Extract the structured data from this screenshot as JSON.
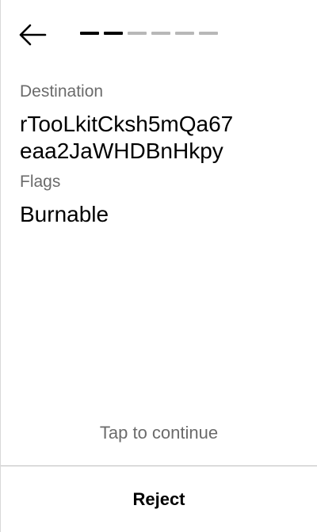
{
  "header": {
    "back_icon": "arrow-left-icon",
    "progress": {
      "total_steps": 6,
      "completed_steps": 2,
      "done_color": "#000000",
      "pending_color": "#b8b8b8"
    }
  },
  "fields": {
    "destination": {
      "label": "Destination",
      "value_line1": "rTooLkitCksh5mQa67",
      "value_line2": "eaa2JaWHDBnHkpy"
    },
    "flags": {
      "label": "Flags",
      "value": "Burnable"
    }
  },
  "footer": {
    "hint": "Tap to continue",
    "reject_label": "Reject"
  }
}
